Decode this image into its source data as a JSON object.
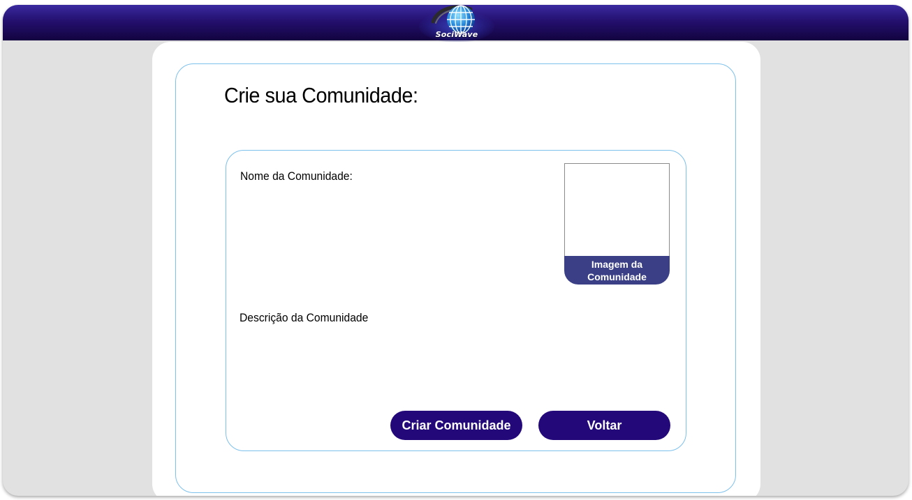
{
  "header": {
    "logo_text": "SociWave",
    "logo_icon": "globe-icon",
    "colors": {
      "header_top": "#3a2aa0",
      "header_bottom": "#12033f"
    }
  },
  "page": {
    "title": "Crie sua Comunidade:"
  },
  "form": {
    "name_label": "Nome da Comunidade:",
    "name_value": "",
    "description_label": "Descrição da Comunidade",
    "description_value": "",
    "image_caption_line1": "Imagem da",
    "image_caption_line2": "Comunidade",
    "create_button_label": "Criar Comunidade",
    "back_button_label": "Voltar"
  },
  "colors": {
    "background": "#e1e1e1",
    "card": "#ffffff",
    "panel_border": "#7cc0ec",
    "button": "#23087a",
    "image_caption_bg": "#3a3f86"
  }
}
